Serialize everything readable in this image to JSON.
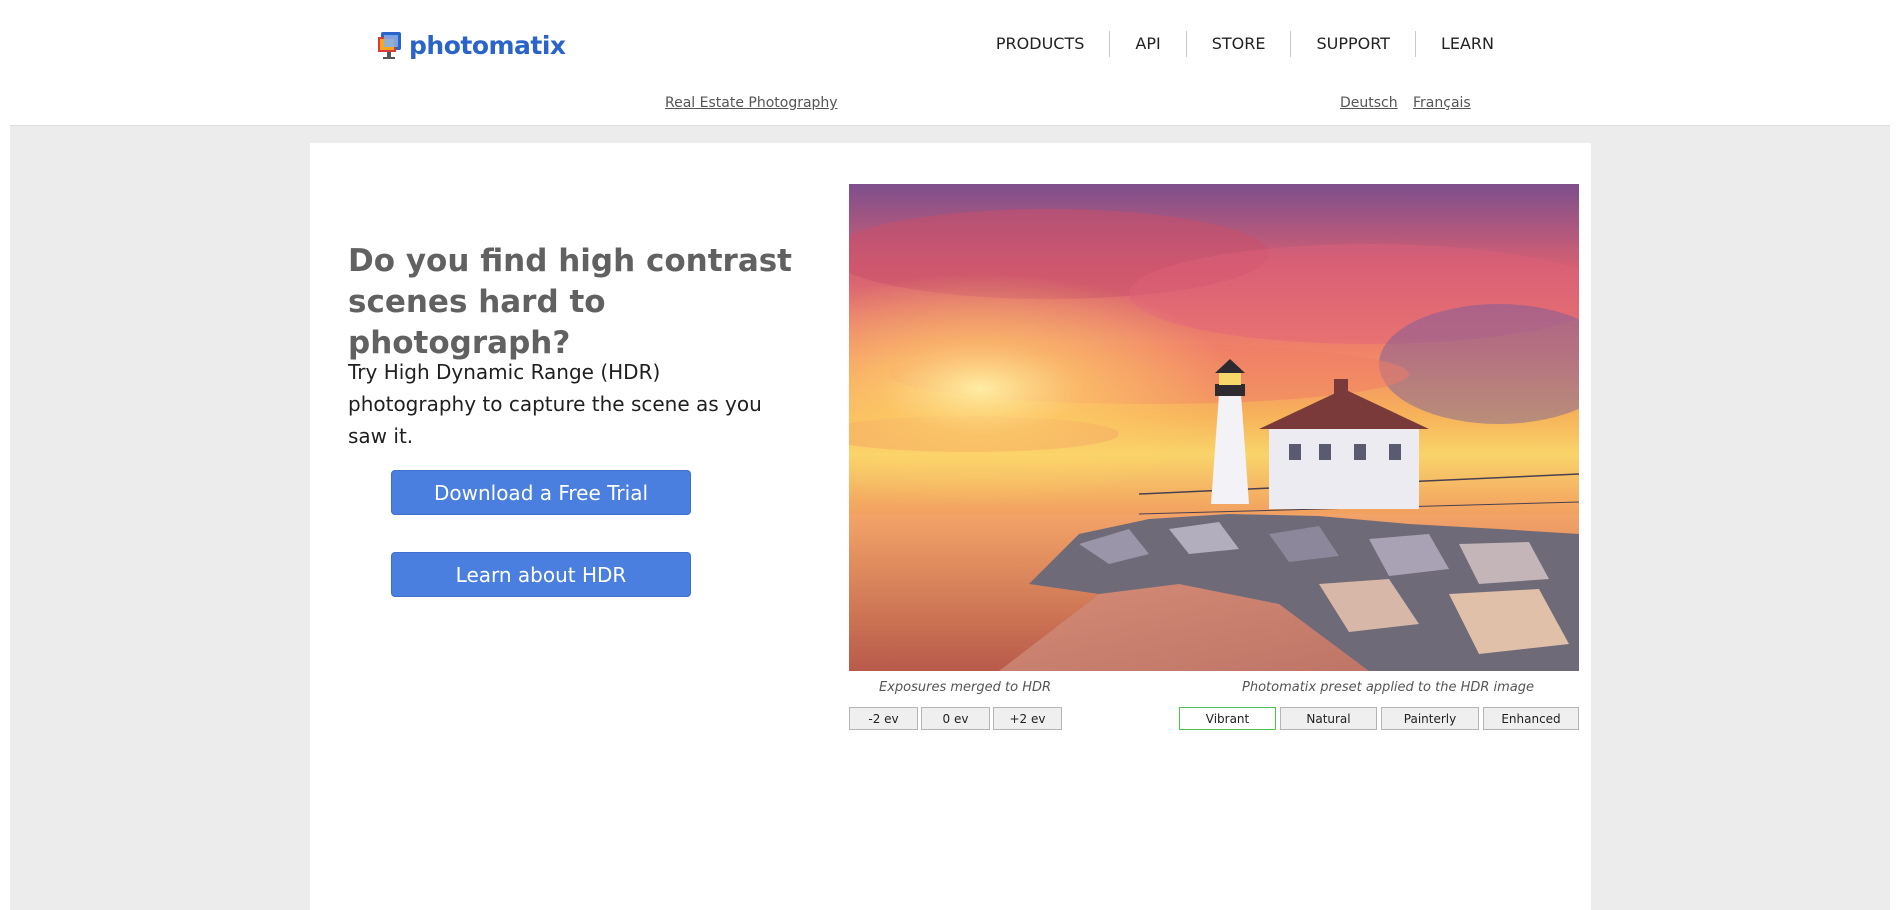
{
  "brand": {
    "name": "photomatix",
    "color": "#2a63c9"
  },
  "nav": {
    "items": [
      {
        "label": "PRODUCTS"
      },
      {
        "label": "API"
      },
      {
        "label": "STORE"
      },
      {
        "label": "SUPPORT"
      },
      {
        "label": "LEARN"
      }
    ]
  },
  "subnav": {
    "link": "Real Estate Photography",
    "languages": [
      "Deutsch",
      "Français"
    ]
  },
  "hero": {
    "headline": "Do you find high contrast scenes hard to photograph?",
    "lead": "Try High Dynamic Range (HDR) photography to capture the scene as you saw it.",
    "primary_button": "Download a Free Trial",
    "secondary_button": "Learn about HDR",
    "button_color": "#4a7fe0"
  },
  "image_panel": {
    "exposures_caption": "Exposures merged to HDR",
    "exposures": [
      "-2 ev",
      "0 ev",
      "+2 ev"
    ],
    "presets_caption": "Photomatix preset applied to the HDR image",
    "presets": [
      "Vibrant",
      "Natural",
      "Painterly",
      "Enhanced"
    ],
    "active_preset": "Vibrant",
    "active_color": "#4fc24f"
  }
}
